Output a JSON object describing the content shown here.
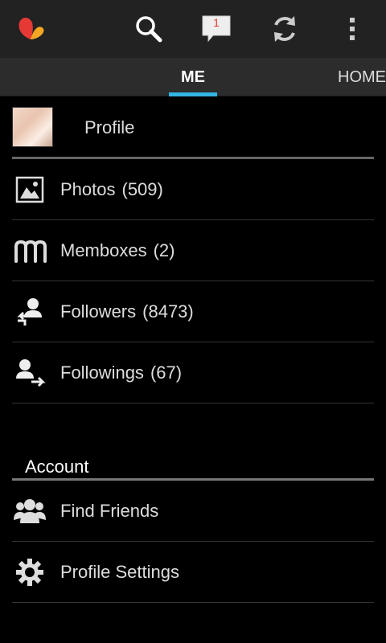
{
  "actionbar": {
    "logo_icon": "app-logo-icon",
    "search_icon": "search-icon",
    "notifications_icon": "chat-notification-icon",
    "notifications_count": "1",
    "refresh_icon": "refresh-icon",
    "overflow_icon": "overflow-menu-icon"
  },
  "tabs": [
    {
      "label": "ME",
      "selected": true
    },
    {
      "label": "HOME",
      "selected": false
    }
  ],
  "colors": {
    "accent": "#33b5e5",
    "actionbar_bg": "#222222",
    "tabbar_bg": "#2c2c2c",
    "badge_text": "#e53935"
  },
  "profile": {
    "label": "Profile"
  },
  "menu": [
    {
      "label": "Photos",
      "count": "(509)",
      "icon": "photo-icon"
    },
    {
      "label": "Memboxes",
      "count": "(2)",
      "icon": "membox-icon"
    },
    {
      "label": "Followers",
      "count": "(8473)",
      "icon": "followers-icon"
    },
    {
      "label": "Followings",
      "count": "(67)",
      "icon": "followings-icon"
    }
  ],
  "account": {
    "header": "Account",
    "items": [
      {
        "label": "Find Friends",
        "icon": "find-friends-icon"
      },
      {
        "label": "Profile Settings",
        "icon": "settings-gear-icon"
      }
    ]
  }
}
